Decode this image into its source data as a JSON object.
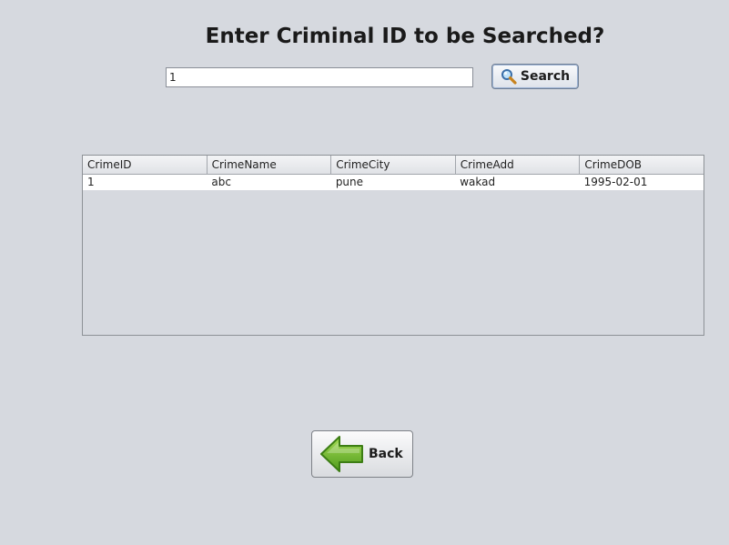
{
  "page": {
    "title": "Enter Criminal ID to be Searched?"
  },
  "search": {
    "value": "1",
    "button_label": "Search",
    "icon": "magnifier-icon"
  },
  "table": {
    "columns": [
      "CrimeID",
      "CrimeName",
      "CrimeCity",
      "CrimeAdd",
      "CrimeDOB"
    ],
    "rows": [
      [
        "1",
        "abc",
        "pune",
        "wakad",
        "1995-02-01"
      ]
    ]
  },
  "back": {
    "label": "Back",
    "icon": "back-arrow-icon"
  },
  "colors": {
    "background": "#d6d9df",
    "arrow_green": "#6cb52d"
  }
}
